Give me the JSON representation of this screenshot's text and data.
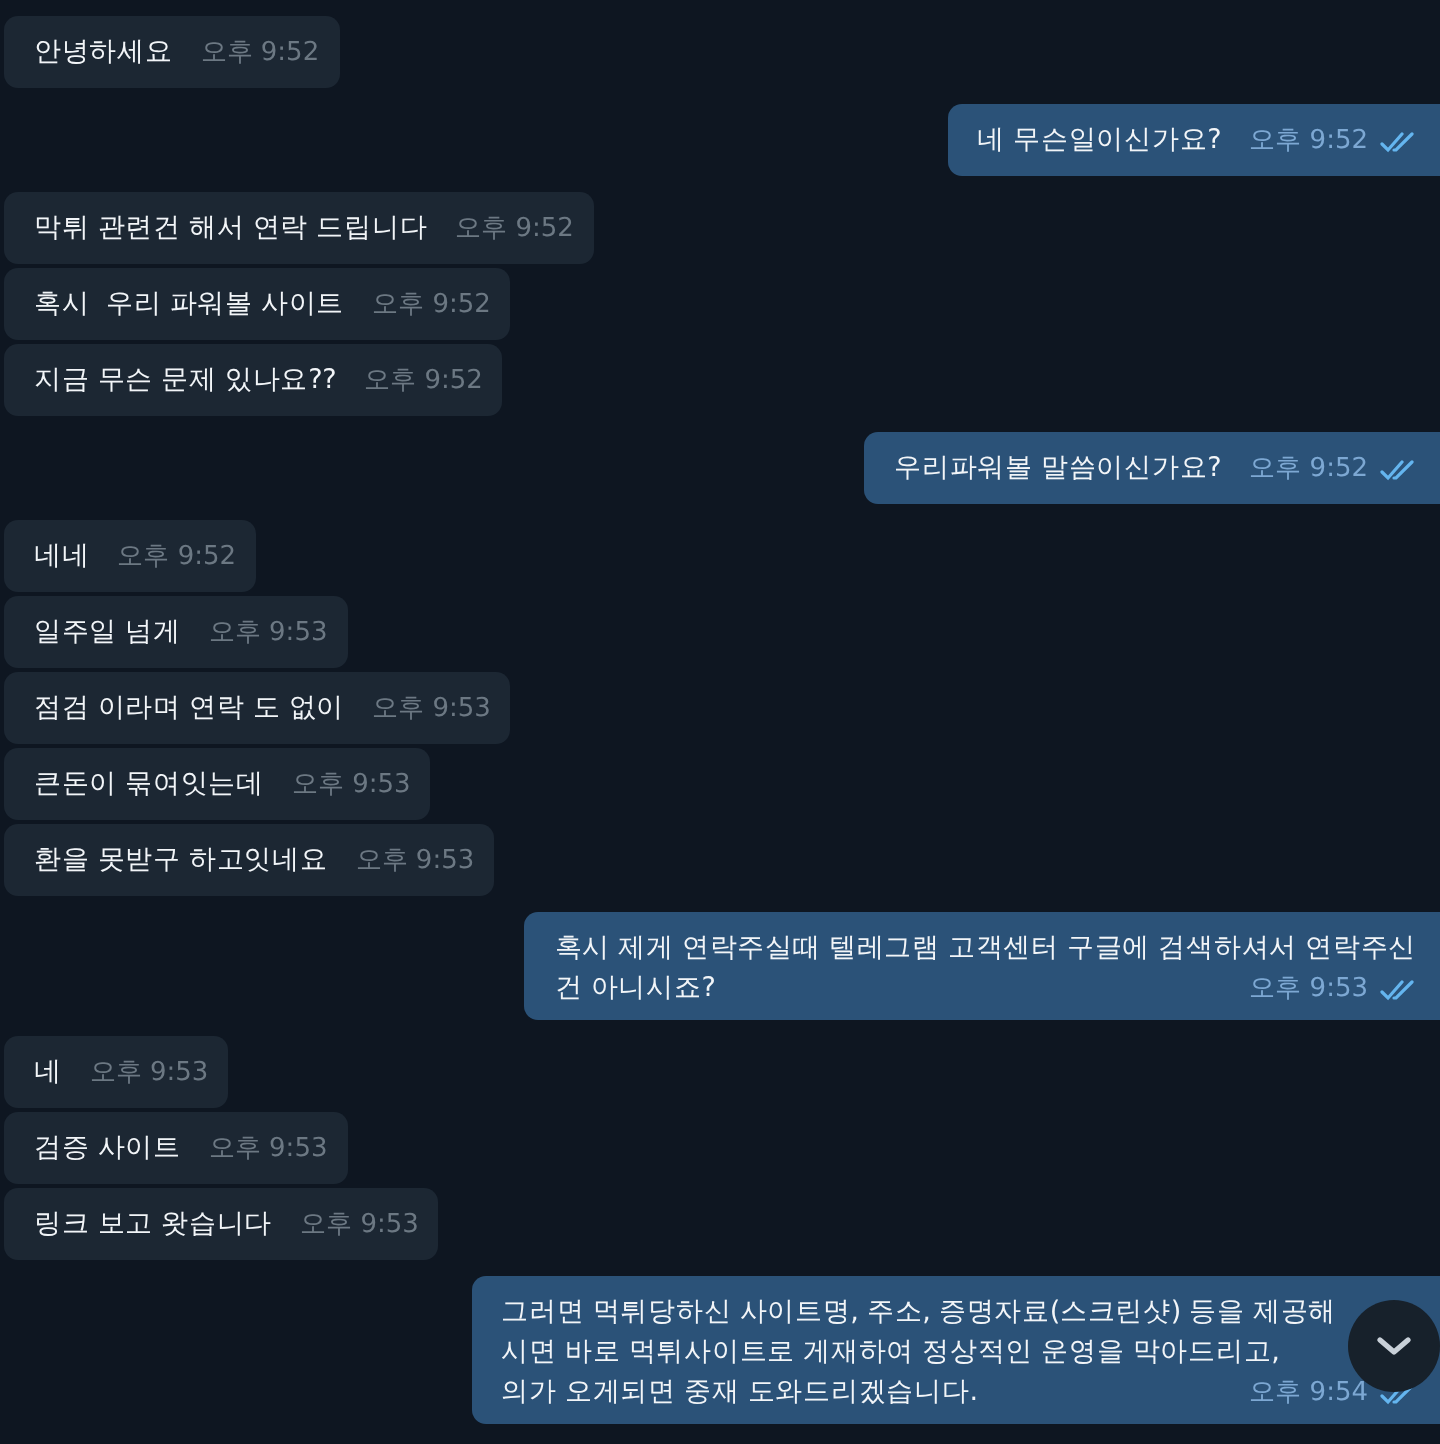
{
  "messages": [
    {
      "kind": "incoming",
      "lines": [
        "안녕하세요"
      ],
      "time": "오후 9:52"
    },
    {
      "kind": "outgoing",
      "lines": [
        "네 무슨일이신가요?"
      ],
      "time": "오후 9:52",
      "read": true
    },
    {
      "kind": "incoming",
      "lines": [
        "막튀 관련건 해서 연락 드립니다"
      ],
      "time": "오후 9:52"
    },
    {
      "kind": "incoming",
      "lines": [
        "혹시  우리 파워볼 사이트"
      ],
      "time": "오후 9:52"
    },
    {
      "kind": "incoming",
      "lines": [
        "지금 무슨 문제 있나요??"
      ],
      "time": "오후 9:52"
    },
    {
      "kind": "outgoing",
      "lines": [
        "우리파워볼 말씀이신가요?"
      ],
      "time": "오후 9:52",
      "read": true
    },
    {
      "kind": "incoming",
      "lines": [
        "네네"
      ],
      "time": "오후 9:52"
    },
    {
      "kind": "incoming",
      "lines": [
        "일주일 넘게"
      ],
      "time": "오후 9:53"
    },
    {
      "kind": "incoming",
      "lines": [
        "점검 이라며 연락 도 없이"
      ],
      "time": "오후 9:53"
    },
    {
      "kind": "incoming",
      "lines": [
        "큰돈이 묶여잇는데"
      ],
      "time": "오후 9:53"
    },
    {
      "kind": "incoming",
      "lines": [
        "환을 못받구 하고잇네요"
      ],
      "time": "오후 9:53"
    },
    {
      "kind": "outgoing",
      "lines": [
        "혹시 제게 연락주실때 텔레그램 고객센터 구글에 검색하셔서 연락주신",
        "건 아니시죠?"
      ],
      "time": "오후 9:53",
      "read": true
    },
    {
      "kind": "incoming",
      "lines": [
        "네"
      ],
      "time": "오후 9:53"
    },
    {
      "kind": "incoming",
      "lines": [
        "검증 사이트"
      ],
      "time": "오후 9:53"
    },
    {
      "kind": "incoming",
      "lines": [
        "링크 보고 왓습니다"
      ],
      "time": "오후 9:53"
    },
    {
      "kind": "outgoing",
      "lines": [
        "그러면 먹튀당하신 사이트명, 주소, 증명자료(스크린샷) 등을 제공해",
        "시면 바로 먹튀사이트로 게재하여 정상적인 운영을 막아드리고,",
        "의가 오게되면 중재 도와드리겠습니다."
      ],
      "time": "오후 9:54",
      "read": true
    }
  ],
  "scroll_button": {
    "visible": true
  }
}
